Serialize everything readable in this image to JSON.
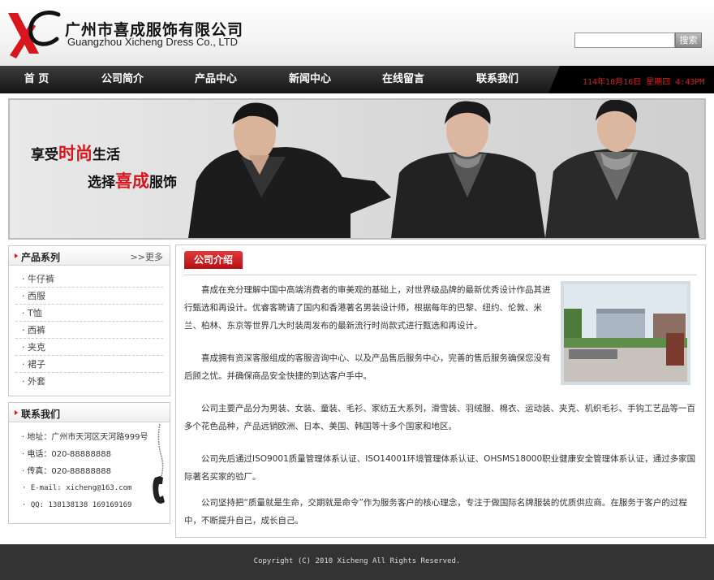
{
  "header": {
    "company_cn": "广州市喜成服饰有限公司",
    "company_en": "Guangzhou Xicheng Dress Co., LTD",
    "logo_icon": "xc-logo-icon",
    "search_button": "搜索",
    "search_value": ""
  },
  "nav": {
    "items": [
      "首 页",
      "公司简介",
      "产品中心",
      "新闻中心",
      "在线留言",
      "联系我们"
    ],
    "datetime": "114年10月16日 星期四 4:43PM"
  },
  "banner": {
    "slogan1_a": "享受",
    "slogan1_b": "时尚",
    "slogan1_c": "生活",
    "slogan2_a": "选择",
    "slogan2_b": "喜成",
    "slogan2_c": "服饰"
  },
  "products": {
    "title": "产品系列",
    "more": ">>更多",
    "items": [
      "牛仔裤",
      "西服",
      "T恤",
      "西裤",
      "夹克",
      "裙子",
      "外套"
    ]
  },
  "contact": {
    "title": "联系我们",
    "items": [
      "地址：广州市天河区天河路999号",
      "电话：020-88888888",
      "传真：020-88888888",
      "E-mail: xicheng@163.com",
      "QQ: 138138138 169169169"
    ],
    "phone_icon": "telephone-icon"
  },
  "main": {
    "tab": "公司介绍",
    "paragraphs": [
      "喜成在充分理解中国中高端消费者的审美观的基础上，对世界级品牌的最新优秀设计作品其进行甄选和再设计。优睿客聘请了国内和香港著名男装设计师，根据每年的巴黎、纽约、伦敦、米兰、柏林、东京等世界几大时装周发布的最新流行时尚款式进行甄选和再设计。",
      "喜成拥有资深客服组成的客服咨询中心、以及产品售后服务中心，完善的售后服务确保您没有后顾之忧。并确保商品安全快捷的到达客户手中。",
      "公司主要产品分为男装、女装、童装、毛衫、家纺五大系列，滑雪装、羽绒服、棉衣、运动装、夹克、机织毛衫、手钩工艺品等一百多个花色品种，产品远销欧洲、日本、美国、韩国等十多个国家和地区。",
      "公司先后通过ISO9001质量管理体系认证、ISO14001环境管理体系认证、OHSMS18000职业健康安全管理体系认证，通过多家国际著名买家的验厂。",
      "公司坚持把“质量就是生命，交期就是命令”作为服务客户的核心理念，专注于做国际名牌服装的优质供应商。在服务于客户的过程中，不断提升自己，成长自己。"
    ]
  },
  "footer": {
    "copyright": "Copyright (C) 2010 Xicheng All Rights Reserved."
  },
  "colors": {
    "accent_red": "#d8161d",
    "nav_dark": "#1a1a1a",
    "footer_bg": "#333333"
  }
}
